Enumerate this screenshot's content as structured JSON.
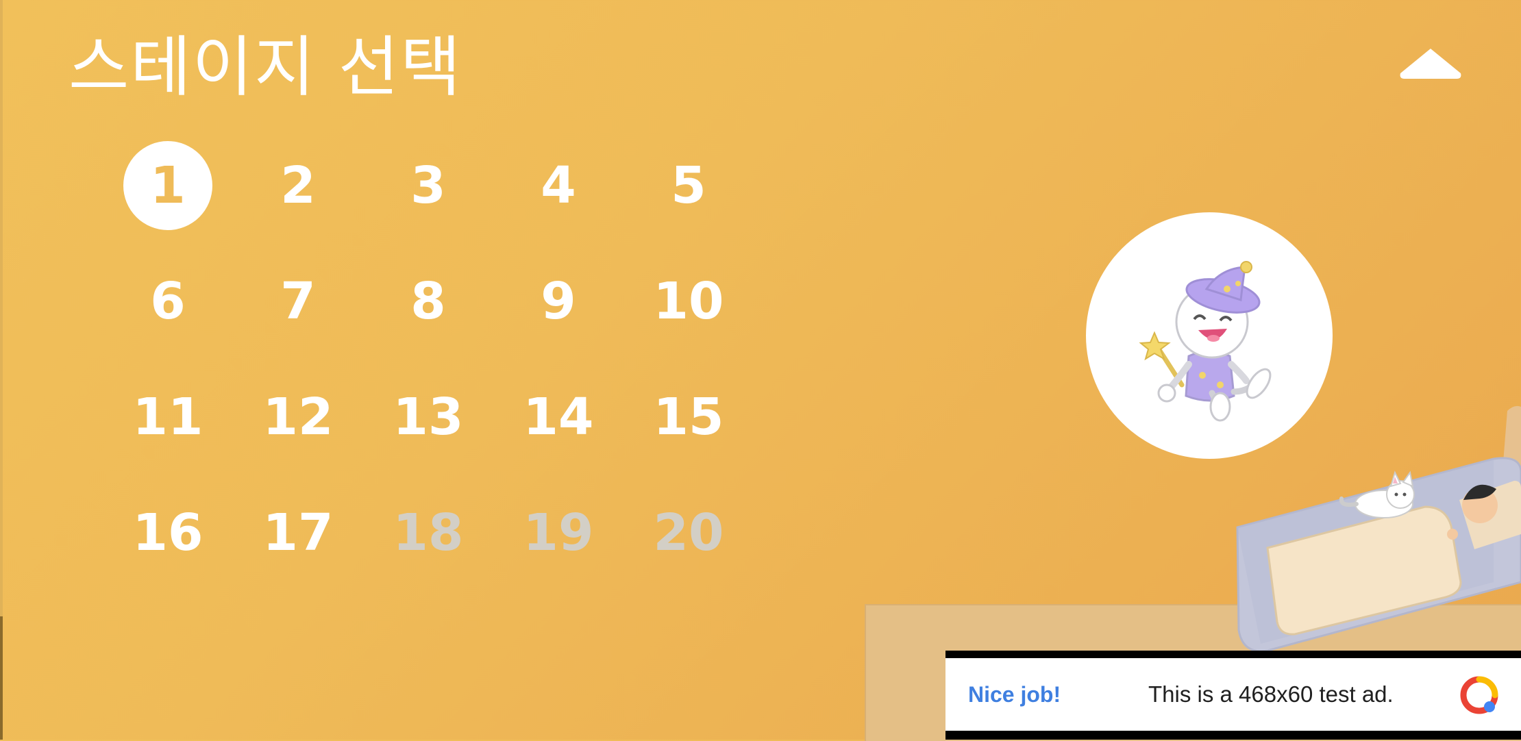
{
  "header": {
    "title": "스테이지 선택",
    "collapse_icon": "chevron-up-icon"
  },
  "stages": {
    "selected": 1,
    "items": [
      {
        "label": "1",
        "state": "selected"
      },
      {
        "label": "2",
        "state": "unlocked"
      },
      {
        "label": "3",
        "state": "unlocked"
      },
      {
        "label": "4",
        "state": "unlocked"
      },
      {
        "label": "5",
        "state": "unlocked"
      },
      {
        "label": "6",
        "state": "unlocked"
      },
      {
        "label": "7",
        "state": "unlocked"
      },
      {
        "label": "8",
        "state": "unlocked"
      },
      {
        "label": "9",
        "state": "unlocked"
      },
      {
        "label": "10",
        "state": "unlocked"
      },
      {
        "label": "11",
        "state": "unlocked"
      },
      {
        "label": "12",
        "state": "unlocked"
      },
      {
        "label": "13",
        "state": "unlocked"
      },
      {
        "label": "14",
        "state": "unlocked"
      },
      {
        "label": "15",
        "state": "unlocked"
      },
      {
        "label": "16",
        "state": "unlocked"
      },
      {
        "label": "17",
        "state": "unlocked"
      },
      {
        "label": "18",
        "state": "locked"
      },
      {
        "label": "19",
        "state": "locked"
      },
      {
        "label": "20",
        "state": "locked"
      }
    ]
  },
  "character": {
    "icon": "wizard-character-icon"
  },
  "ad": {
    "headline": "Nice job!",
    "body": "This is a 468x60 test ad.",
    "icon": "ad-choices-icon"
  },
  "colors": {
    "background": "#efbb58",
    "accent_text": "#ffffff",
    "locked_text": "#d3cfc6",
    "ad_headline": "#3f7fe0"
  }
}
